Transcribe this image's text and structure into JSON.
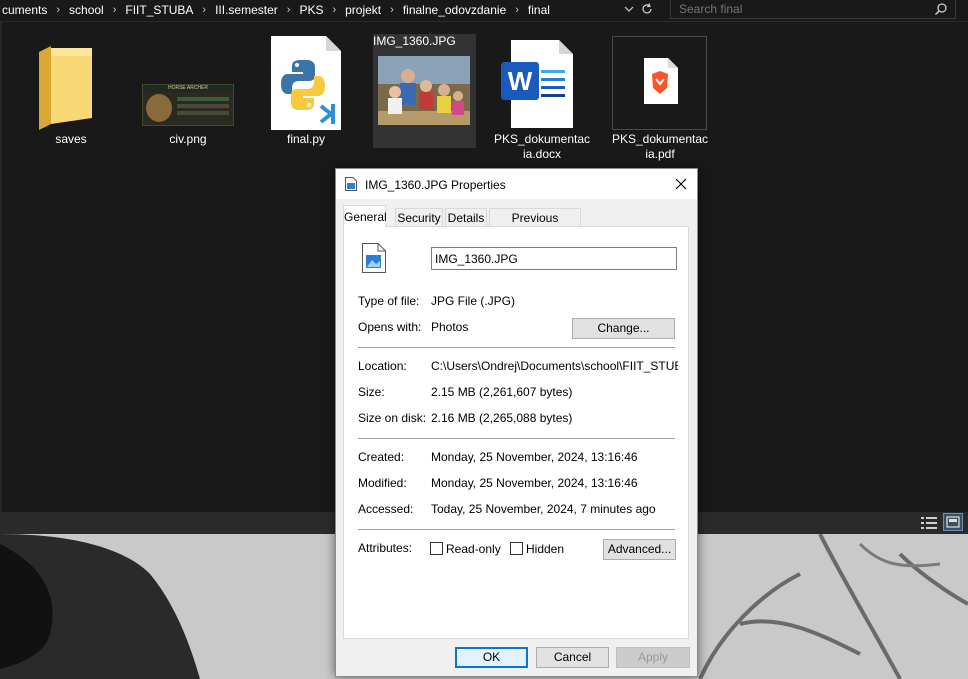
{
  "explorer": {
    "breadcrumb": [
      "cuments",
      "school",
      "FIIT_STUBA",
      "III.semester",
      "PKS",
      "projekt",
      "finalne_odovzdanie",
      "final"
    ],
    "search_placeholder": "Search final",
    "files": [
      {
        "name": "saves",
        "icon": "folder-icon"
      },
      {
        "name": "civ.png",
        "icon": "image-thumbnail",
        "thumb_title": "HORSE ARCHER"
      },
      {
        "name": "final.py",
        "icon": "python-file-icon"
      },
      {
        "name": "IMG_1360.JPG",
        "icon": "photo-thumbnail"
      },
      {
        "name_line1": "PKS_dokumentac",
        "name_line2": "ia.docx",
        "icon": "word-file-icon"
      },
      {
        "name_line1": "PKS_dokumentac",
        "name_line2": "ia.pdf",
        "icon": "brave-pdf-icon"
      }
    ]
  },
  "dialog": {
    "title": "IMG_1360.JPG Properties",
    "tabs": [
      "General",
      "Security",
      "Details",
      "Previous Versions"
    ],
    "filename": "IMG_1360.JPG",
    "type_label": "Type of file:",
    "type_value": "JPG File (.JPG)",
    "opens_label": "Opens with:",
    "opens_value": "Photos",
    "change_button": "Change...",
    "location_label": "Location:",
    "location_value": "C:\\Users\\Ondrej\\Documents\\school\\FIIT_STUBA\\I",
    "size_label": "Size:",
    "size_value": "2.15 MB (2,261,607 bytes)",
    "size_on_disk_label": "Size on disk:",
    "size_on_disk_value": "2.16 MB (2,265,088 bytes)",
    "created_label": "Created:",
    "created_value": "Monday, 25 November, 2024, 13:16:46",
    "modified_label": "Modified:",
    "modified_value": "Monday, 25 November, 2024, 13:16:46",
    "accessed_label": "Accessed:",
    "accessed_value": "Today, 25 November, 2024, 7 minutes ago",
    "attributes_label": "Attributes:",
    "readonly_label": "Read-only",
    "hidden_label": "Hidden",
    "advanced_button": "Advanced...",
    "ok_button": "OK",
    "cancel_button": "Cancel",
    "apply_button": "Apply"
  },
  "colors": {
    "explorer_bg": "#191919",
    "accent": "#0078d7",
    "word_blue": "#185abd",
    "brave_orange": "#fb542b"
  }
}
